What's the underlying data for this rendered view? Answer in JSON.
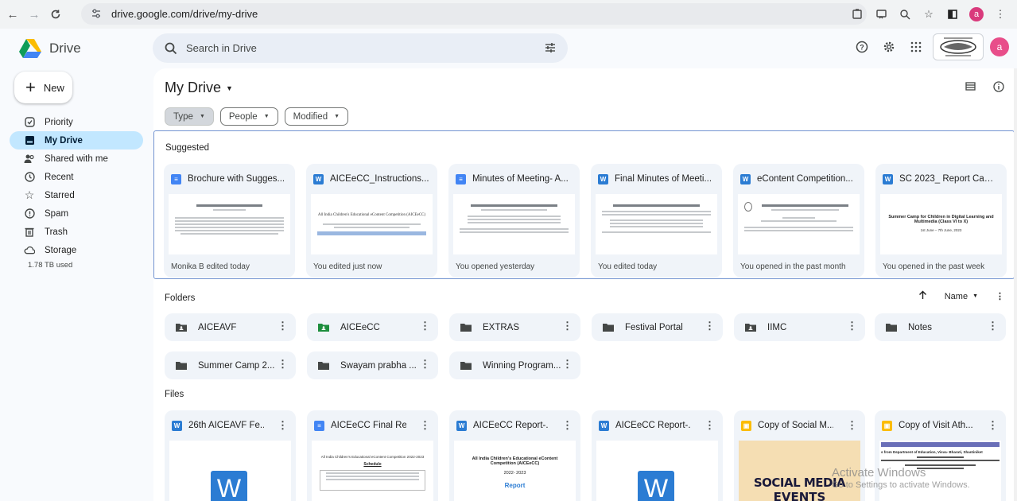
{
  "browser": {
    "url": "drive.google.com/drive/my-drive",
    "profile_initial": "a"
  },
  "app": {
    "name": "Drive",
    "search_placeholder": "Search in Drive",
    "avatar_initial": "a"
  },
  "sidebar": {
    "new_label": "New",
    "items": [
      {
        "label": "Priority",
        "icon": "priority-icon"
      },
      {
        "label": "My Drive",
        "icon": "my-drive-icon",
        "active": true
      },
      {
        "label": "Shared with me",
        "icon": "shared-icon"
      },
      {
        "label": "Recent",
        "icon": "clock-icon"
      },
      {
        "label": "Starred",
        "icon": "star-icon"
      },
      {
        "label": "Spam",
        "icon": "spam-icon"
      },
      {
        "label": "Trash",
        "icon": "trash-icon"
      },
      {
        "label": "Storage",
        "icon": "cloud-icon"
      }
    ],
    "storage_used": "1.78 TB used"
  },
  "main": {
    "title": "My Drive",
    "filters": [
      "Type",
      "People",
      "Modified"
    ],
    "suggested_label": "Suggested",
    "suggested": [
      {
        "title": "Brochure with Sugges...",
        "type": "doc",
        "activity": "Monika B edited today"
      },
      {
        "title": "AICEeCC_Instructions...",
        "type": "word",
        "activity": "You edited just now"
      },
      {
        "title": "Minutes of Meeting- A...",
        "type": "doc",
        "activity": "You opened yesterday"
      },
      {
        "title": "Final Minutes of Meeti...",
        "type": "word",
        "activity": "You edited today"
      },
      {
        "title": "eContent Competition...",
        "type": "word",
        "activity": "You opened in the past month"
      },
      {
        "title": "SC 2023_ Report Cam...",
        "type": "word",
        "activity": "You opened in the past week"
      }
    ],
    "folders_label": "Folders",
    "sort_label": "Name",
    "folders": [
      {
        "name": "AICEAVF",
        "kind": "shared"
      },
      {
        "name": "AICEeCC",
        "kind": "shared-green"
      },
      {
        "name": "EXTRAS",
        "kind": "plain"
      },
      {
        "name": "Festival Portal",
        "kind": "plain"
      },
      {
        "name": "IIMC",
        "kind": "shared"
      },
      {
        "name": "Notes",
        "kind": "plain"
      },
      {
        "name": "Summer Camp 2...",
        "kind": "plain"
      },
      {
        "name": "Swayam prabha ...",
        "kind": "plain"
      },
      {
        "name": "Winning Program...",
        "kind": "plain"
      }
    ],
    "files_label": "Files",
    "files": [
      {
        "title": "26th AICEAVF Fe...",
        "type": "word"
      },
      {
        "title": "AICEeCC Final Re...",
        "type": "doc"
      },
      {
        "title": "AICEeCC Report-...",
        "type": "word"
      },
      {
        "title": "AICEeCC Report-...",
        "type": "word"
      },
      {
        "title": "Copy of Social M...",
        "type": "slide"
      },
      {
        "title": "Copy of Visit Ath...",
        "type": "slide"
      }
    ],
    "thumb_texts": {
      "file2_title": "All India Children's Educational eContent Competition 2022-2023",
      "file2_heading": "Schedule",
      "file3_title": "All India Children's Educational eContent Competition (AICEeCC)",
      "file3_year": "2022- 2023",
      "file3_report": "Report",
      "file5_social": "SOCIAL MEDIA",
      "file5_events": "EVENTS",
      "file6_line": "s from Department of Education, Visva- Bharati, Shantiniket",
      "sugg2_title": "All India Children's Educational eContent Competition (AICEeCC)",
      "sugg6_title": "Summer Camp for Children in Digital Learning and Multimedia (Class VI to X)",
      "sugg6_dates": "1st June – 7th June, 2023"
    }
  },
  "watermark": {
    "line1": "Activate Windows",
    "line2": "Go to Settings to activate Windows."
  },
  "colors": {
    "active_nav": "#c2e7ff",
    "card_bg": "#f0f4f9",
    "accent_blue": "#4285f4",
    "word_blue": "#2b7cd3",
    "slide_yellow": "#fbbc04"
  }
}
